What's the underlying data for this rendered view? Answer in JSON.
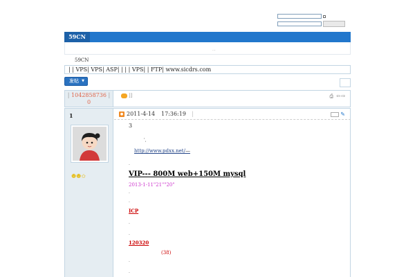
{
  "site": {
    "tab_label": "59CN",
    "breadcrumb": "59CN"
  },
  "notice": {
    "text": "| | VPS| VPS|   ASP| | | | VPS| | FTP|   www.sicdrs.com"
  },
  "toolbar": {
    "post_label": "发帖",
    "post_caret": "▼"
  },
  "thread": {
    "id_text": "1042858736",
    "sep": "|",
    "replies": "0",
    "title_text": "]]",
    "tools": "⎙ ⇦⇨"
  },
  "post": {
    "floor": "1",
    "date": "2011-4-14",
    "time": "17:36:19",
    "pipe": "|",
    "medals": "☻☻✩",
    "content": {
      "num": "3",
      "tiny": "',",
      "link": "http://www.pdxx.net/",
      "link_tail": "—",
      "vip": "VIP--- 800M web+150M                  mysql     ",
      "date_line": "2013-1-11\"21\"\"20\"",
      "icp": "ICP",
      "num2": "120320     ",
      "count": "(38)"
    }
  }
}
